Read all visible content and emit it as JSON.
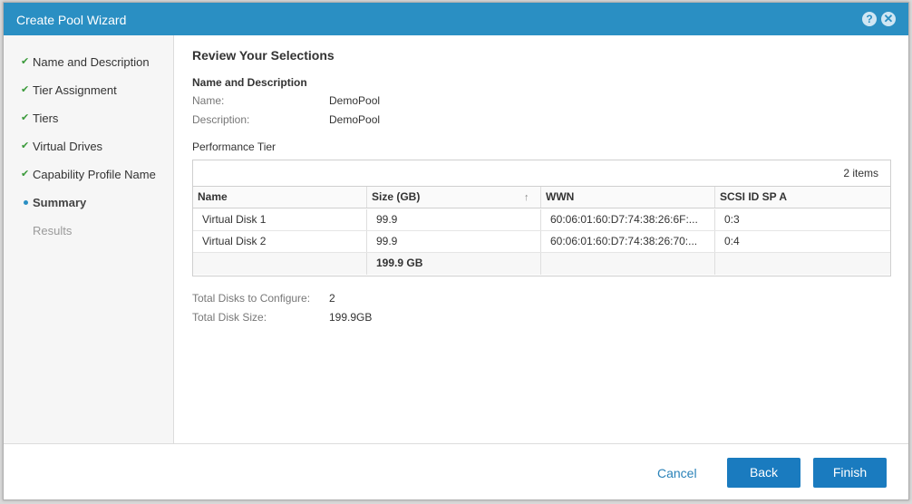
{
  "titlebar": {
    "title": "Create Pool Wizard",
    "help_icon": "?",
    "close_icon": "✕"
  },
  "steps": [
    {
      "label": "Name and Description",
      "state": "done"
    },
    {
      "label": "Tier Assignment",
      "state": "done"
    },
    {
      "label": "Tiers",
      "state": "done"
    },
    {
      "label": "Virtual Drives",
      "state": "done"
    },
    {
      "label": "Capability Profile Name",
      "state": "done"
    },
    {
      "label": "Summary",
      "state": "current"
    },
    {
      "label": "Results",
      "state": "disabled"
    }
  ],
  "main": {
    "heading": "Review Your Selections",
    "name_desc_title": "Name and Description",
    "name_label": "Name:",
    "name_value": "DemoPool",
    "desc_label": "Description:",
    "desc_value": "DemoPool",
    "perf_tier_label": "Performance Tier",
    "grid": {
      "count": "2 items",
      "columns": [
        "Name",
        "Size (GB)",
        "WWN",
        "SCSI ID SP A"
      ],
      "sort_icon": "↑",
      "rows": [
        [
          "Virtual Disk 1",
          "99.9",
          "60:06:01:60:D7:74:38:26:6F:...",
          "0:3"
        ],
        [
          "Virtual Disk 2",
          "99.9",
          "60:06:01:60:D7:74:38:26:70:...",
          "0:4"
        ]
      ],
      "total": [
        "",
        "199.9 GB",
        "",
        ""
      ]
    },
    "total_disks_label": "Total Disks to Configure:",
    "total_disks_value": "2",
    "total_size_label": "Total Disk Size:",
    "total_size_value": "199.9GB"
  },
  "footer": {
    "cancel": "Cancel",
    "back": "Back",
    "finish": "Finish"
  },
  "colors": {
    "accent": "#2a8fc3",
    "button": "#1a7bbf",
    "check": "#3a9a3a"
  }
}
